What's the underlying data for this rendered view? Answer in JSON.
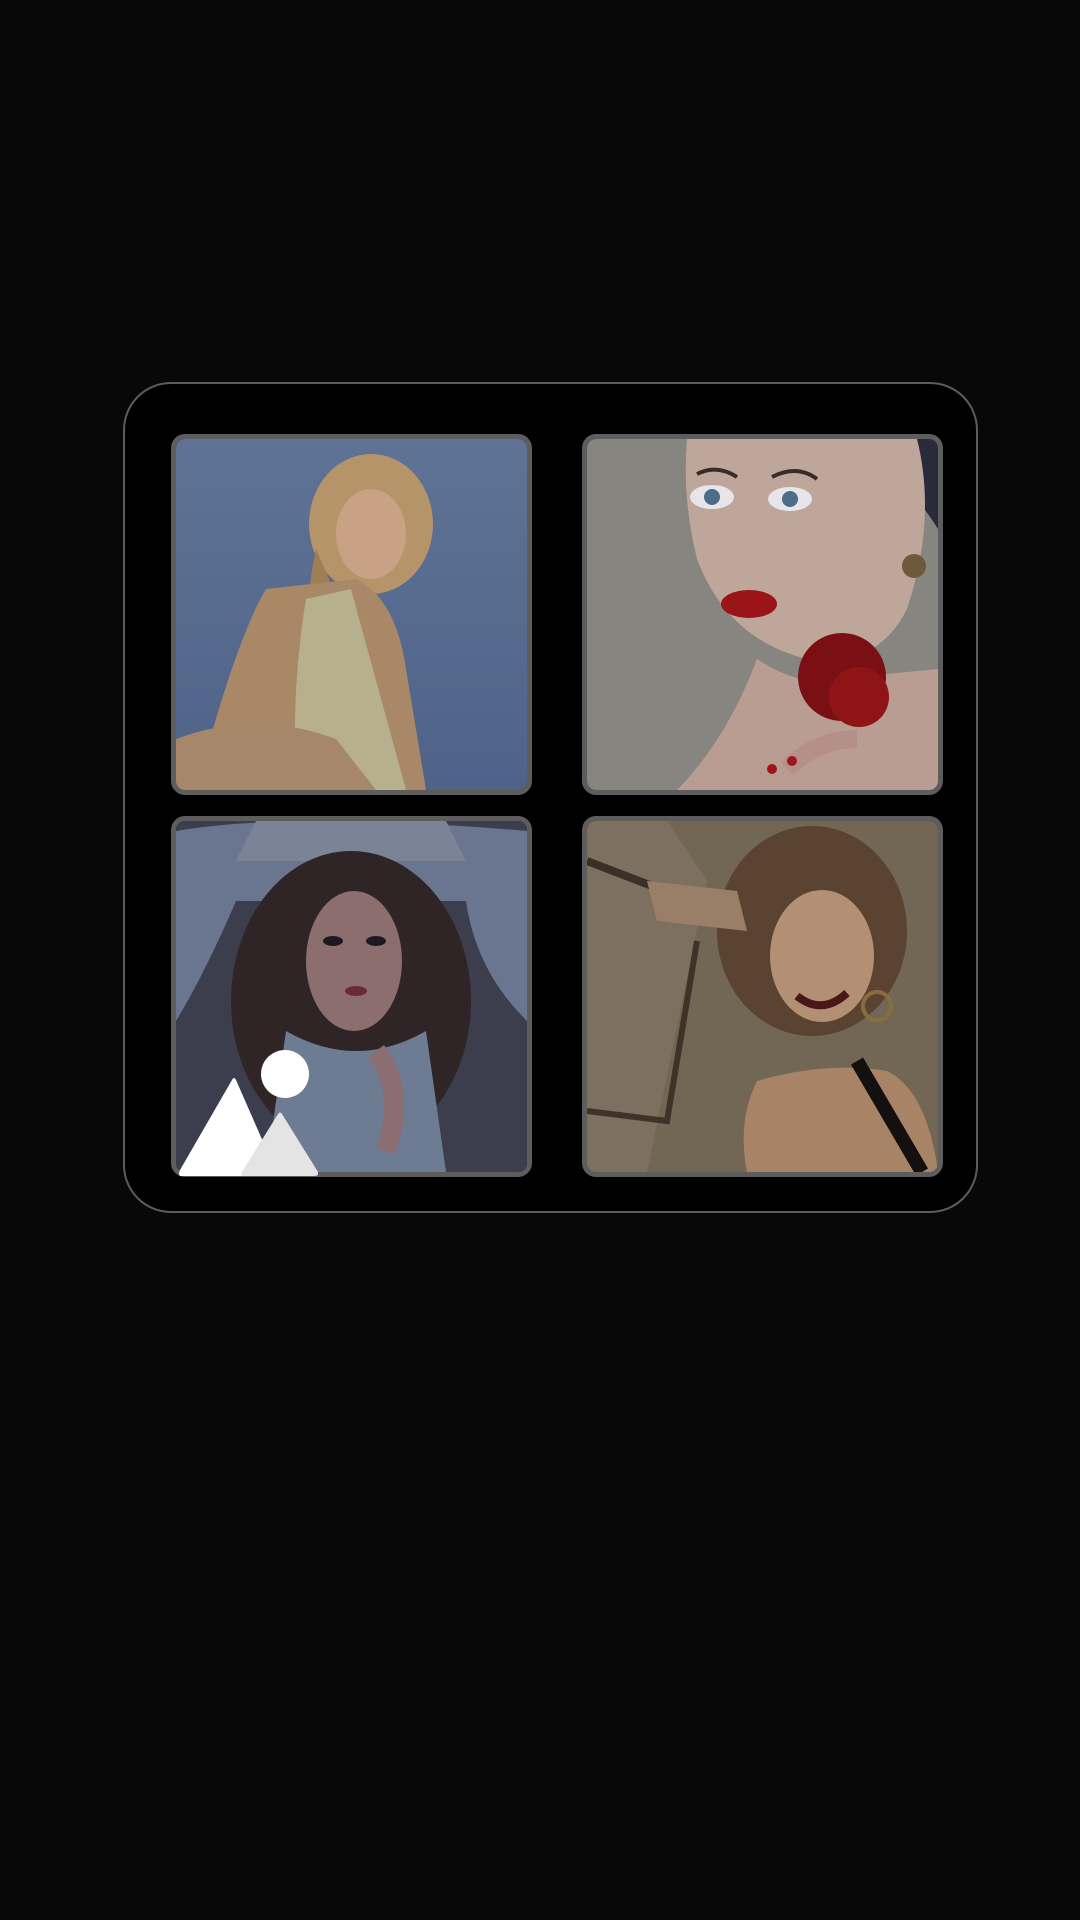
{
  "collage": {
    "layout": "2x2 grid",
    "photos": [
      {
        "icon": "portrait-photo-blonde-woman"
      },
      {
        "icon": "portrait-photo-woman-with-rose"
      },
      {
        "icon": "portrait-photo-curly-hair-woman"
      },
      {
        "icon": "portrait-photo-smiling-woman"
      }
    ]
  },
  "gallery_button": {
    "icon": "gallery-image-icon"
  },
  "colors": {
    "background": "#080808",
    "card_background": "#000000",
    "card_border": "#5c5c5c",
    "tile_border": "#5d5d5d",
    "icon": "#ffffff"
  }
}
